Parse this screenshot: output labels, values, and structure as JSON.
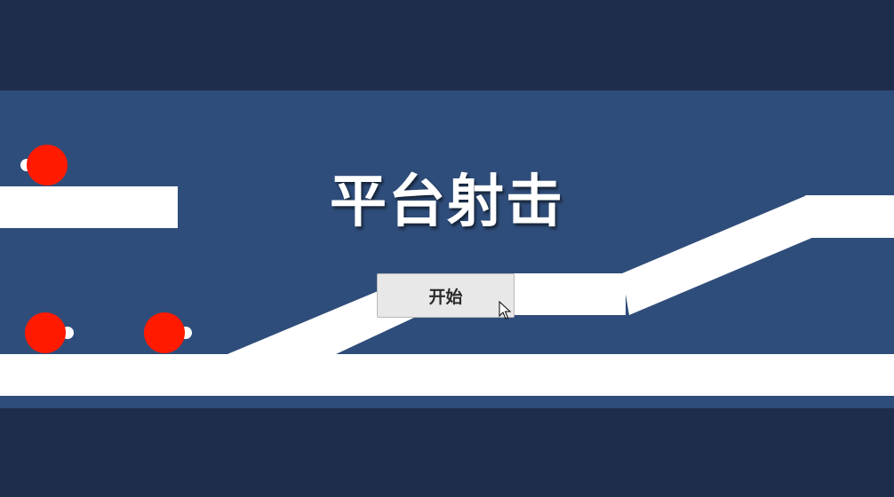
{
  "game": {
    "title": "平台射击",
    "start_button_label": "开始"
  },
  "colors": {
    "letterbox": "#1f2d4d",
    "background": "#2f4d7a",
    "platform": "#ffffff",
    "enemy": "#ff1a00",
    "button": "#e8e8e8"
  },
  "entities": {
    "enemies": [
      {
        "name": "enemy-top-left",
        "facing": "left"
      },
      {
        "name": "enemy-bottom-left",
        "facing": "right"
      },
      {
        "name": "enemy-bottom-middle",
        "facing": "right"
      }
    ]
  }
}
